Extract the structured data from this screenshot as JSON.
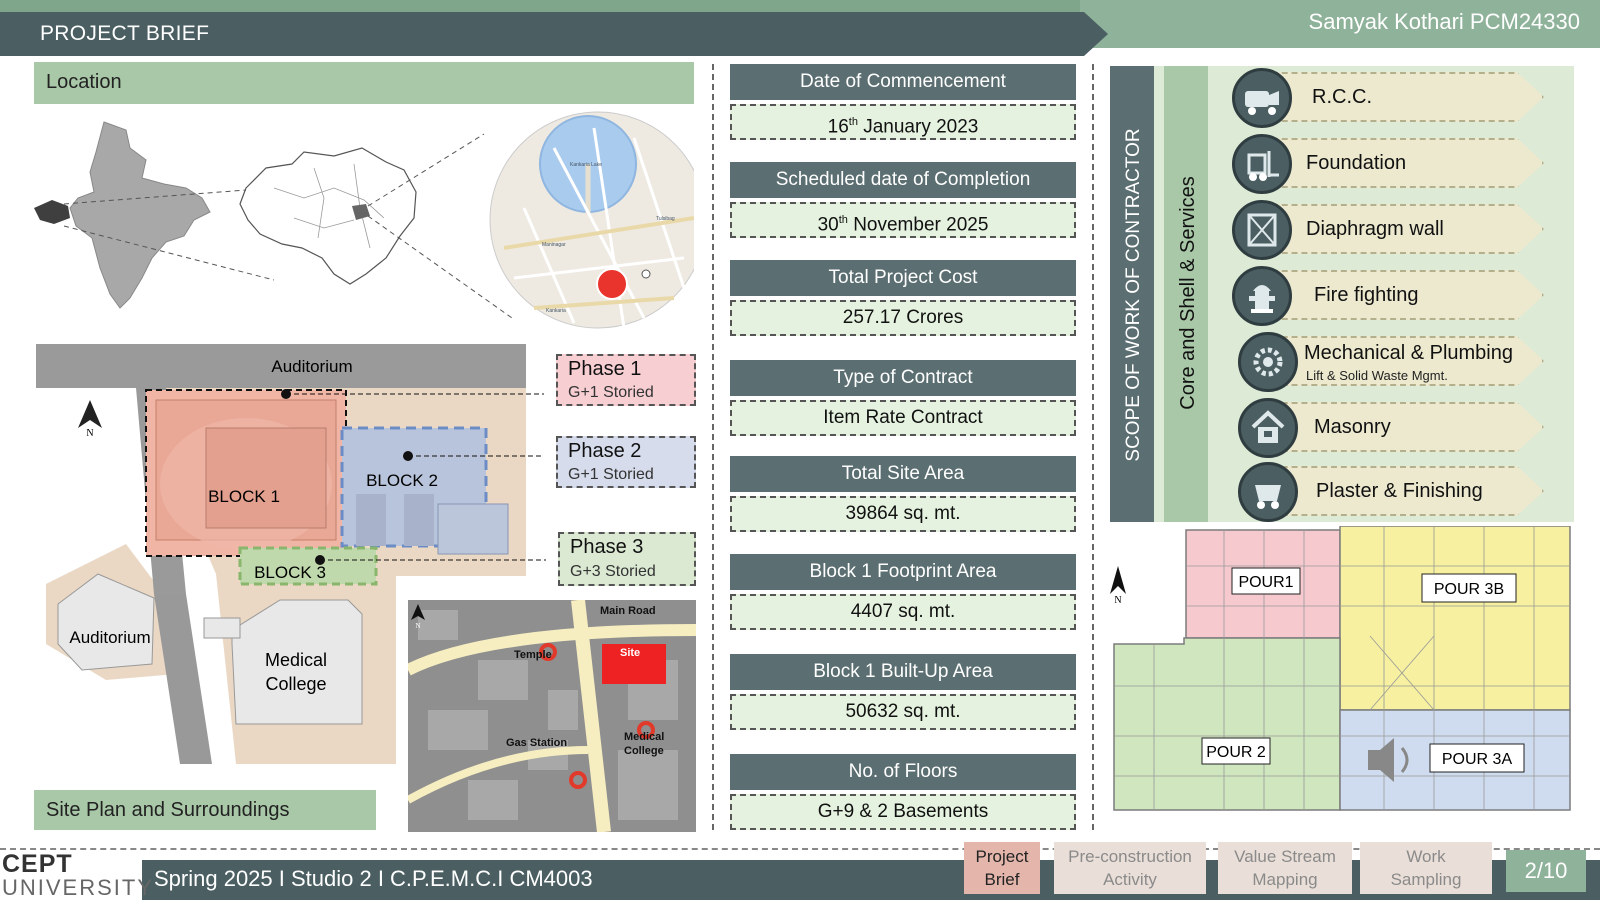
{
  "header": {
    "title": "PROJECT BRIEF",
    "author": "Samyak Kothari PCM24330"
  },
  "location": {
    "label": "Location",
    "map_labels": {
      "lake": "Kankaria Lake",
      "lake_road": "Tulsibag",
      "area_1": "Maninagar",
      "area_2": "Kankaria"
    }
  },
  "site_plan": {
    "label": "Site Plan and Surroundings",
    "north": "N",
    "auditorium_top": "Auditorium",
    "block1": "BLOCK 1",
    "block2": "BLOCK 2",
    "block3": "BLOCK 3",
    "auditorium_left": "Auditorium",
    "medical_1": "Medical",
    "medical_2": "College",
    "phases": [
      {
        "name": "Phase 1",
        "storeys": "G+1 Storied",
        "color": "#f7cfd3"
      },
      {
        "name": "Phase 2",
        "storeys": "G+1 Storied",
        "color": "#d6dcec"
      },
      {
        "name": "Phase 3",
        "storeys": "G+3 Storied",
        "color": "#dbe9d3"
      }
    ]
  },
  "surroundings": {
    "main_road": "Main Road",
    "temple": "Temple",
    "site": "Site",
    "gas_station": "Gas Station",
    "medical_1": "Medical",
    "medical_2": "College",
    "north": "N"
  },
  "info": {
    "date_commencement": {
      "label": "Date of Commencement",
      "day": "16",
      "sup": "th",
      "rest": " January 2023"
    },
    "date_completion": {
      "label": "Scheduled date of Completion",
      "day": "30",
      "sup": "th",
      "rest": " November 2025"
    },
    "cost": {
      "label": "Total Project Cost",
      "value": "257.17 Crores"
    },
    "contract": {
      "label": "Type of Contract",
      "value": "Item Rate Contract"
    },
    "site_area": {
      "label": "Total Site Area",
      "value": "39864 sq. mt."
    },
    "footprint": {
      "label": "Block 1 Footprint Area",
      "value": "4407 sq. mt."
    },
    "built_up": {
      "label": "Block 1 Built-Up Area",
      "value": "50632 sq. mt."
    },
    "floors": {
      "label": "No. of Floors",
      "value": "G+9 & 2 Basements"
    }
  },
  "scope": {
    "title": "SCOPE OF WORK OF CONTRACTOR",
    "subtitle": "Core and Shell & Services",
    "items": [
      {
        "label": "R.C.C.",
        "icon": "concrete-mixer-icon"
      },
      {
        "label": "Foundation",
        "icon": "forklift-icon"
      },
      {
        "label": "Diaphragm wall",
        "icon": "wall-panel-icon"
      },
      {
        "label": "Fire fighting",
        "icon": "fire-hydrant-icon"
      },
      {
        "label": "Mechanical & Plumbing",
        "sub": "Lift & Solid Waste Mgmt.",
        "icon": "gear-icon"
      },
      {
        "label": "Masonry",
        "icon": "house-icon"
      },
      {
        "label": "Plaster & Finishing",
        "icon": "trolley-icon"
      }
    ]
  },
  "pour_plan": {
    "north": "N",
    "pour1": "POUR1",
    "pour3b": "POUR 3B",
    "pour2": "POUR 2",
    "pour3a": "POUR 3A",
    "colors": {
      "pour1": "#f6c9cf",
      "pour3b": "#f6f0a0",
      "pour2": "#cfe6bf",
      "pour3a": "#cfdcef"
    }
  },
  "footer": {
    "logo_top": "CEPT",
    "logo_bottom": "UNIVERSITY",
    "course": "Spring 2025 I Studio 2 I C.P.E.M.C.I CM4003",
    "tabs": [
      {
        "line1": "Project",
        "line2": "Brief"
      },
      {
        "line1": "Pre-construction",
        "line2": "Activity"
      },
      {
        "line1": "Value Stream",
        "line2": "Mapping"
      },
      {
        "line1": "Work",
        "line2": "Sampling"
      }
    ],
    "page": "2/10"
  }
}
